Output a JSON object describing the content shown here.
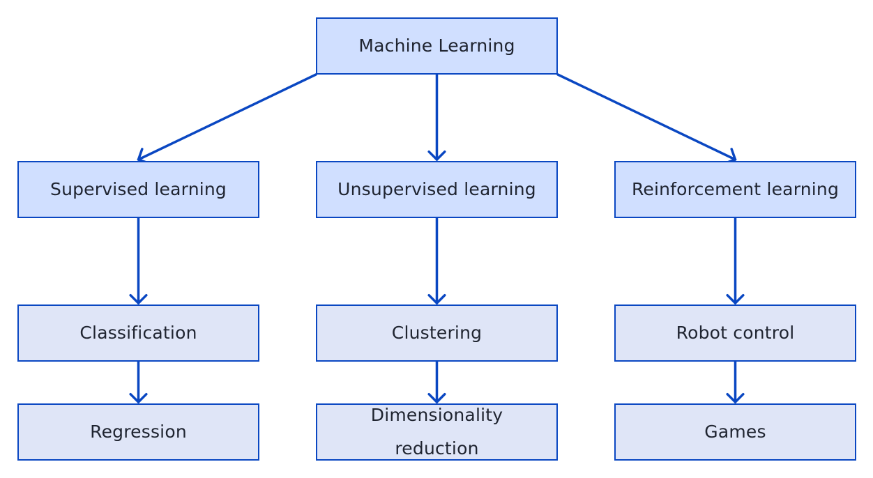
{
  "diagram": {
    "type": "tree",
    "colors": {
      "edge": "#0a47c2",
      "node_border": "#0a47c2",
      "node_fill_primary": "#d0dfff",
      "node_fill_secondary": "#dfe5f7",
      "text": "#1f2430"
    },
    "root": {
      "id": "ml",
      "label": "Machine Learning"
    },
    "categories": [
      {
        "id": "supervised",
        "label": "Supervised learning"
      },
      {
        "id": "unsupervised",
        "label": "Unsupervised learning"
      },
      {
        "id": "reinforcement",
        "label": "Reinforcement learning"
      }
    ],
    "applications": [
      {
        "id": "classification",
        "label": "Classification"
      },
      {
        "id": "clustering",
        "label": "Clustering"
      },
      {
        "id": "robot_control",
        "label": "Robot control"
      }
    ],
    "sub_applications": [
      {
        "id": "regression",
        "label": "Regression"
      },
      {
        "id": "dim_reduction",
        "label": "Dimensionality reduction"
      },
      {
        "id": "games",
        "label": "Games"
      }
    ],
    "edges": [
      {
        "from": "ml",
        "to": "supervised"
      },
      {
        "from": "ml",
        "to": "unsupervised"
      },
      {
        "from": "ml",
        "to": "reinforcement"
      },
      {
        "from": "supervised",
        "to": "classification"
      },
      {
        "from": "unsupervised",
        "to": "clustering"
      },
      {
        "from": "reinforcement",
        "to": "robot_control"
      },
      {
        "from": "classification",
        "to": "regression"
      },
      {
        "from": "clustering",
        "to": "dim_reduction"
      },
      {
        "from": "robot_control",
        "to": "games"
      }
    ]
  }
}
